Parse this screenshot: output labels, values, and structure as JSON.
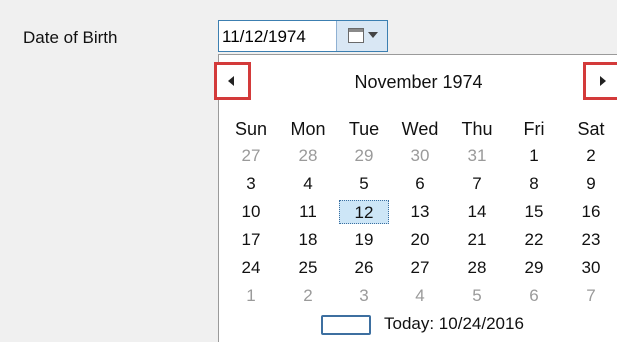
{
  "form": {
    "label": "Date of Birth",
    "value": "11/12/1974"
  },
  "calendar": {
    "month_title": "November 1974",
    "prev_icon": "chevron-left-icon",
    "next_icon": "chevron-right-icon",
    "weekdays": [
      "Sun",
      "Mon",
      "Tue",
      "Wed",
      "Thu",
      "Fri",
      "Sat"
    ],
    "weeks": [
      [
        {
          "d": "27",
          "o": true
        },
        {
          "d": "28",
          "o": true
        },
        {
          "d": "29",
          "o": true
        },
        {
          "d": "30",
          "o": true
        },
        {
          "d": "31",
          "o": true
        },
        {
          "d": "1",
          "o": false
        },
        {
          "d": "2",
          "o": false
        }
      ],
      [
        {
          "d": "3",
          "o": false
        },
        {
          "d": "4",
          "o": false
        },
        {
          "d": "5",
          "o": false
        },
        {
          "d": "6",
          "o": false
        },
        {
          "d": "7",
          "o": false
        },
        {
          "d": "8",
          "o": false
        },
        {
          "d": "9",
          "o": false
        }
      ],
      [
        {
          "d": "10",
          "o": false
        },
        {
          "d": "11",
          "o": false
        },
        {
          "d": "12",
          "o": false,
          "selected": true
        },
        {
          "d": "13",
          "o": false
        },
        {
          "d": "14",
          "o": false
        },
        {
          "d": "15",
          "o": false
        },
        {
          "d": "16",
          "o": false
        }
      ],
      [
        {
          "d": "17",
          "o": false
        },
        {
          "d": "18",
          "o": false
        },
        {
          "d": "19",
          "o": false
        },
        {
          "d": "20",
          "o": false
        },
        {
          "d": "21",
          "o": false
        },
        {
          "d": "22",
          "o": false
        },
        {
          "d": "23",
          "o": false
        }
      ],
      [
        {
          "d": "24",
          "o": false
        },
        {
          "d": "25",
          "o": false
        },
        {
          "d": "26",
          "o": false
        },
        {
          "d": "27",
          "o": false
        },
        {
          "d": "28",
          "o": false
        },
        {
          "d": "29",
          "o": false
        },
        {
          "d": "30",
          "o": false
        }
      ],
      [
        {
          "d": "1",
          "o": true
        },
        {
          "d": "2",
          "o": true
        },
        {
          "d": "3",
          "o": true
        },
        {
          "d": "4",
          "o": true
        },
        {
          "d": "5",
          "o": true
        },
        {
          "d": "6",
          "o": true
        },
        {
          "d": "7",
          "o": true
        }
      ]
    ],
    "today_label": "Today: 10/24/2016"
  },
  "colors": {
    "highlight_border": "#d33a3a",
    "selected_bg": "#cde6f7",
    "other_month_text": "#9a9a9a"
  }
}
